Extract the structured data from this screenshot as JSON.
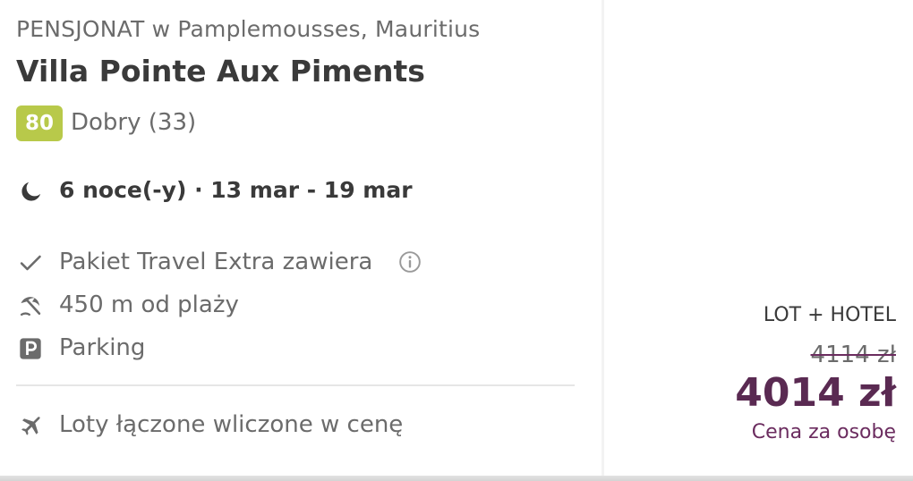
{
  "offer": {
    "type_location": "PENSJONAT w Pamplemousses, Mauritius",
    "hotel_name": "Villa Pointe Aux Piments",
    "rating": {
      "score": "80",
      "label": "Dobry (33)",
      "badge_color": "#b8c94a"
    },
    "stay": "6 noce(-y) · 13 mar - 19 mar",
    "features": [
      {
        "icon": "check-icon",
        "label": "Pakiet Travel Extra zawiera",
        "has_info": true
      },
      {
        "icon": "beach-umbrella-icon",
        "label": "450 m od plaży"
      },
      {
        "icon": "parking-icon",
        "label": "Parking"
      }
    ],
    "flights": {
      "icon": "plane-icon",
      "label": "Loty łączone wliczone w cenę"
    }
  },
  "price": {
    "package_label": "LOT + HOTEL",
    "old_price": "4114 zł",
    "new_price": "4014 zł",
    "per_person": "Cena za osobę",
    "accent_color": "#5a2a52"
  }
}
